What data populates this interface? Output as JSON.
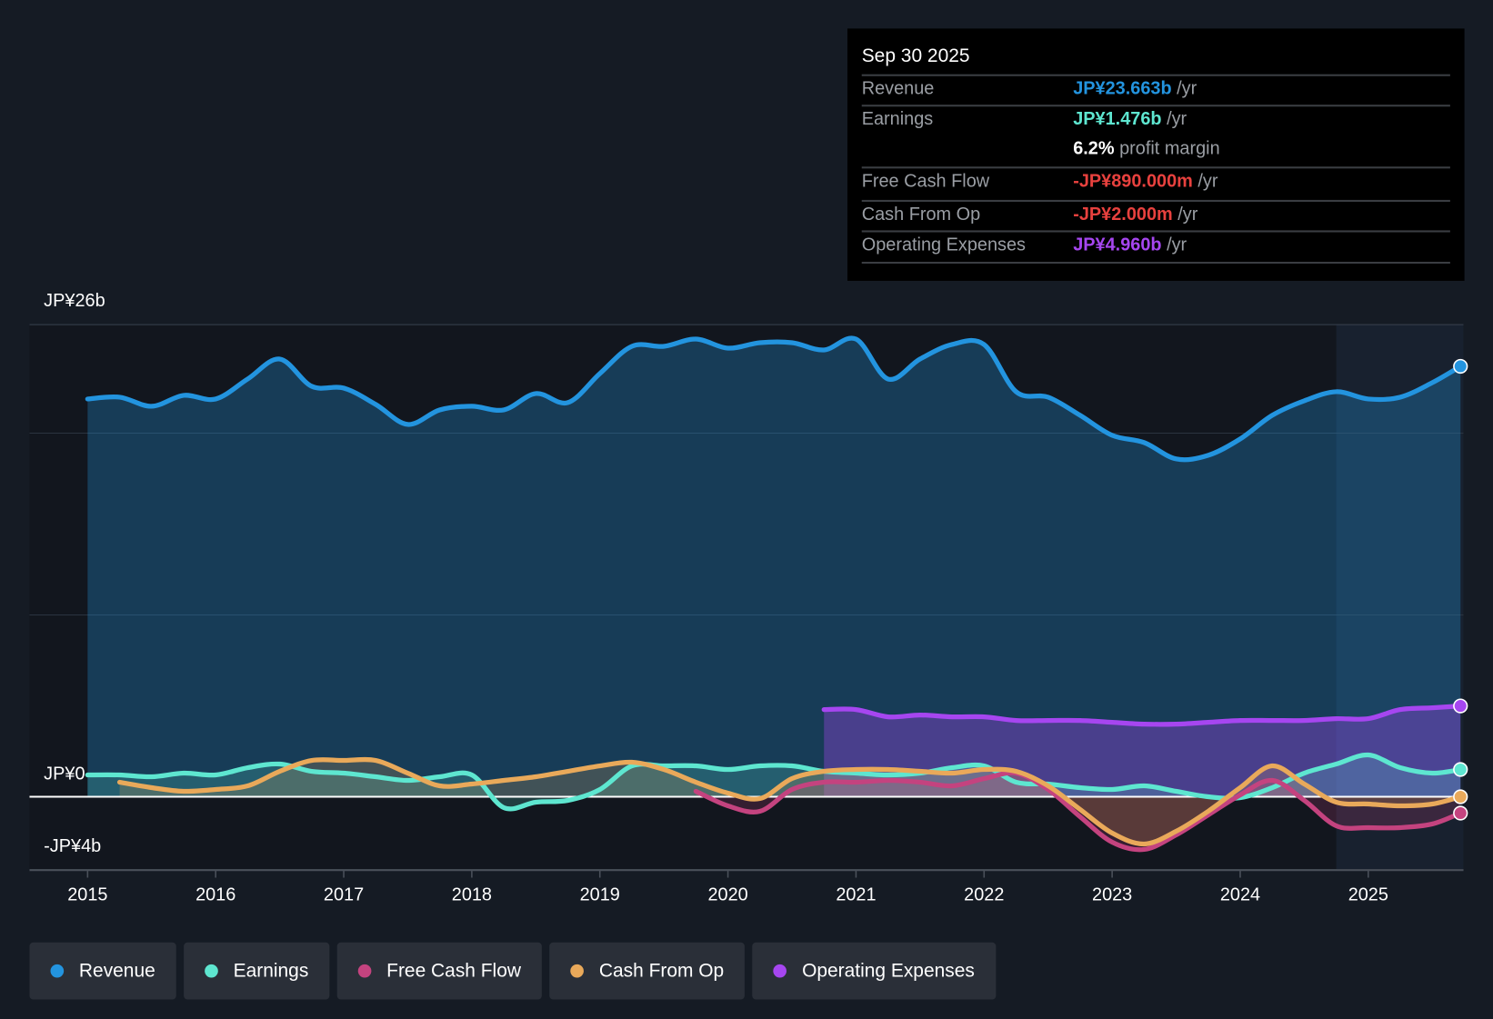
{
  "tooltip": {
    "date": "Sep 30 2025",
    "rows": [
      {
        "label": "Revenue",
        "value": "JP¥23.663b",
        "unit": "/yr",
        "color": "#2394df"
      },
      {
        "label": "Earnings",
        "value": "JP¥1.476b",
        "unit": "/yr",
        "color": "#5ee6d0"
      },
      {
        "label": "",
        "value": "6.2%",
        "unit": "profit margin",
        "color": "#ffffff"
      },
      {
        "label": "Free Cash Flow",
        "value": "-JP¥890.000m",
        "unit": "/yr",
        "color": "#e8413e"
      },
      {
        "label": "Cash From Op",
        "value": "-JP¥2.000m",
        "unit": "/yr",
        "color": "#e8413e"
      },
      {
        "label": "Operating Expenses",
        "value": "JP¥4.960b",
        "unit": "/yr",
        "color": "#a646f0"
      }
    ]
  },
  "chart_data": {
    "type": "line",
    "ylabel": "",
    "xlabel": "",
    "ylim": [
      -4,
      26
    ],
    "y_ticks": [
      "JP¥26b",
      "JP¥0",
      "-JP¥4b"
    ],
    "x_ticks": [
      "2015",
      "2016",
      "2017",
      "2018",
      "2019",
      "2020",
      "2021",
      "2022",
      "2023",
      "2024",
      "2025"
    ],
    "legend_position": "bottom-left",
    "series": [
      {
        "name": "Revenue",
        "color": "#2394df",
        "x0": 2015.0,
        "values": [
          21.9,
          22.0,
          21.5,
          22.1,
          21.9,
          23.0,
          24.1,
          22.6,
          22.5,
          21.6,
          20.5,
          21.3,
          21.5,
          21.3,
          22.2,
          21.7,
          23.3,
          24.8,
          24.8,
          25.2,
          24.7,
          25.0,
          25.0,
          24.6,
          25.2,
          23.0,
          24.1,
          24.9,
          24.9,
          22.3,
          22.0,
          21.0,
          19.9,
          19.5,
          18.6,
          18.8,
          19.7,
          21.0,
          21.8,
          22.3,
          21.9,
          22.0,
          22.8,
          23.7
        ]
      },
      {
        "name": "Earnings",
        "color": "#5ee6d0",
        "x0": 2015.0,
        "values": [
          1.2,
          1.2,
          1.1,
          1.3,
          1.2,
          1.6,
          1.8,
          1.4,
          1.3,
          1.1,
          0.9,
          1.1,
          1.2,
          -0.6,
          -0.3,
          -0.2,
          0.4,
          1.7,
          1.7,
          1.7,
          1.5,
          1.7,
          1.7,
          1.4,
          1.3,
          1.2,
          1.3,
          1.6,
          1.7,
          0.8,
          0.7,
          0.5,
          0.4,
          0.6,
          0.3,
          0.0,
          -0.05,
          0.5,
          1.3,
          1.8,
          2.3,
          1.6,
          1.3,
          1.5
        ]
      },
      {
        "name": "Free Cash Flow",
        "color": "#c4437f",
        "x0": 2019.75,
        "values": [
          0.3,
          -0.5,
          -0.8,
          0.4,
          0.8,
          0.8,
          0.9,
          0.8,
          0.6,
          1.0,
          1.3,
          0.4,
          -1.1,
          -2.5,
          -2.9,
          -2.1,
          -1.0,
          0.1,
          0.9,
          -0.2,
          -1.6,
          -1.7,
          -1.7,
          -1.5,
          -0.9
        ]
      },
      {
        "name": "Cash From Op",
        "color": "#e9a95a",
        "x0": 2015.25,
        "values": [
          0.8,
          0.5,
          0.3,
          0.4,
          0.6,
          1.4,
          2.0,
          2.0,
          2.0,
          1.3,
          0.6,
          0.7,
          0.9,
          1.1,
          1.4,
          1.7,
          1.9,
          1.5,
          0.8,
          0.2,
          -0.1,
          1.0,
          1.4,
          1.5,
          1.5,
          1.4,
          1.3,
          1.5,
          1.4,
          0.6,
          -0.7,
          -2.0,
          -2.6,
          -1.9,
          -0.8,
          0.5,
          1.7,
          0.7,
          -0.3,
          -0.4,
          -0.5,
          -0.4,
          0.0
        ]
      },
      {
        "name": "Operating Expenses",
        "color": "#a646f0",
        "x0": 2020.75,
        "values": [
          4.8,
          4.8,
          4.4,
          4.5,
          4.4,
          4.4,
          4.2,
          4.2,
          4.2,
          4.1,
          4.0,
          4.0,
          4.1,
          4.2,
          4.2,
          4.2,
          4.3,
          4.3,
          4.8,
          4.9,
          5.0
        ]
      }
    ],
    "step": 0.25,
    "x_end": 2025.72,
    "forecast_start": 2024.75
  }
}
